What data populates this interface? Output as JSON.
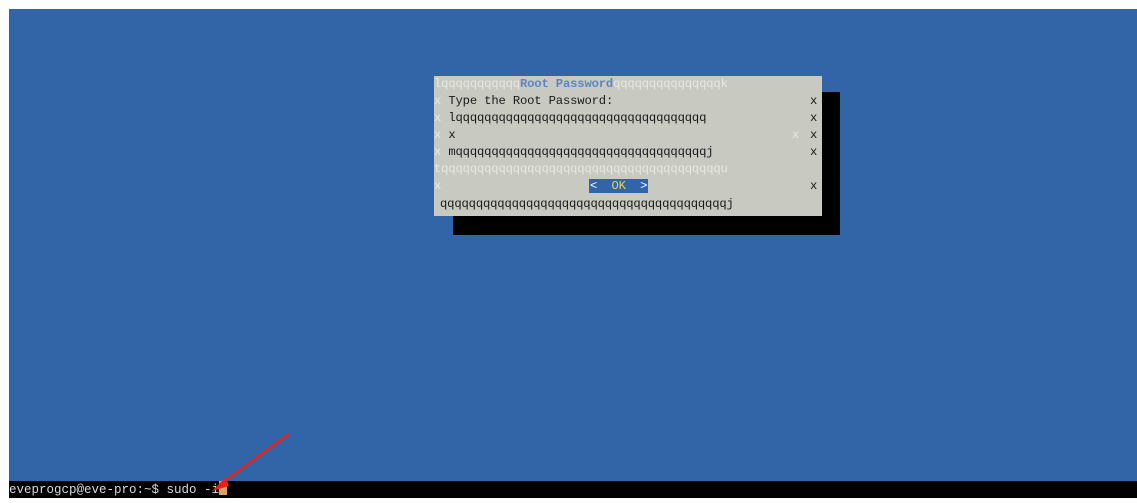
{
  "dialog": {
    "title": "Root Password",
    "title_left_border": "lqqqqqqqqqqq",
    "title_right_border": "qqqqqqqqqqqqqqqk",
    "prompt": "Type the Root Password:",
    "input_top_border": "lqqqqqqqqqqqqqqqqqqqqqqqqqqqqqqqqqqq",
    "input_value": "x",
    "input_bottom_border": "mqqqqqqqqqqqqqqqqqqqqqqqqqqqqqqqqqqqj",
    "separator": "tqqqqqqqqqqqqqqqqqqqqqqqqqqqqqqqqqqqqqqqu",
    "ok_left": "<",
    "ok_label": "OK",
    "ok_right": ">",
    "bottom_border": "qqqqqqqqqqqqqqqqqqqqqqqqqqqqqqqqqqqqqqqqj",
    "side": "x"
  },
  "terminal": {
    "prompt": "eveprogcp@eve-pro:~$",
    "command": "sudo -i"
  },
  "colors": {
    "background": "#3264a8",
    "dialog": "#c8c9c1",
    "shadow": "#000000",
    "title": "#5b86c4",
    "ok_highlight": "#f0d44a",
    "cursor": "#e0a060",
    "arrow": "#e8221b"
  }
}
